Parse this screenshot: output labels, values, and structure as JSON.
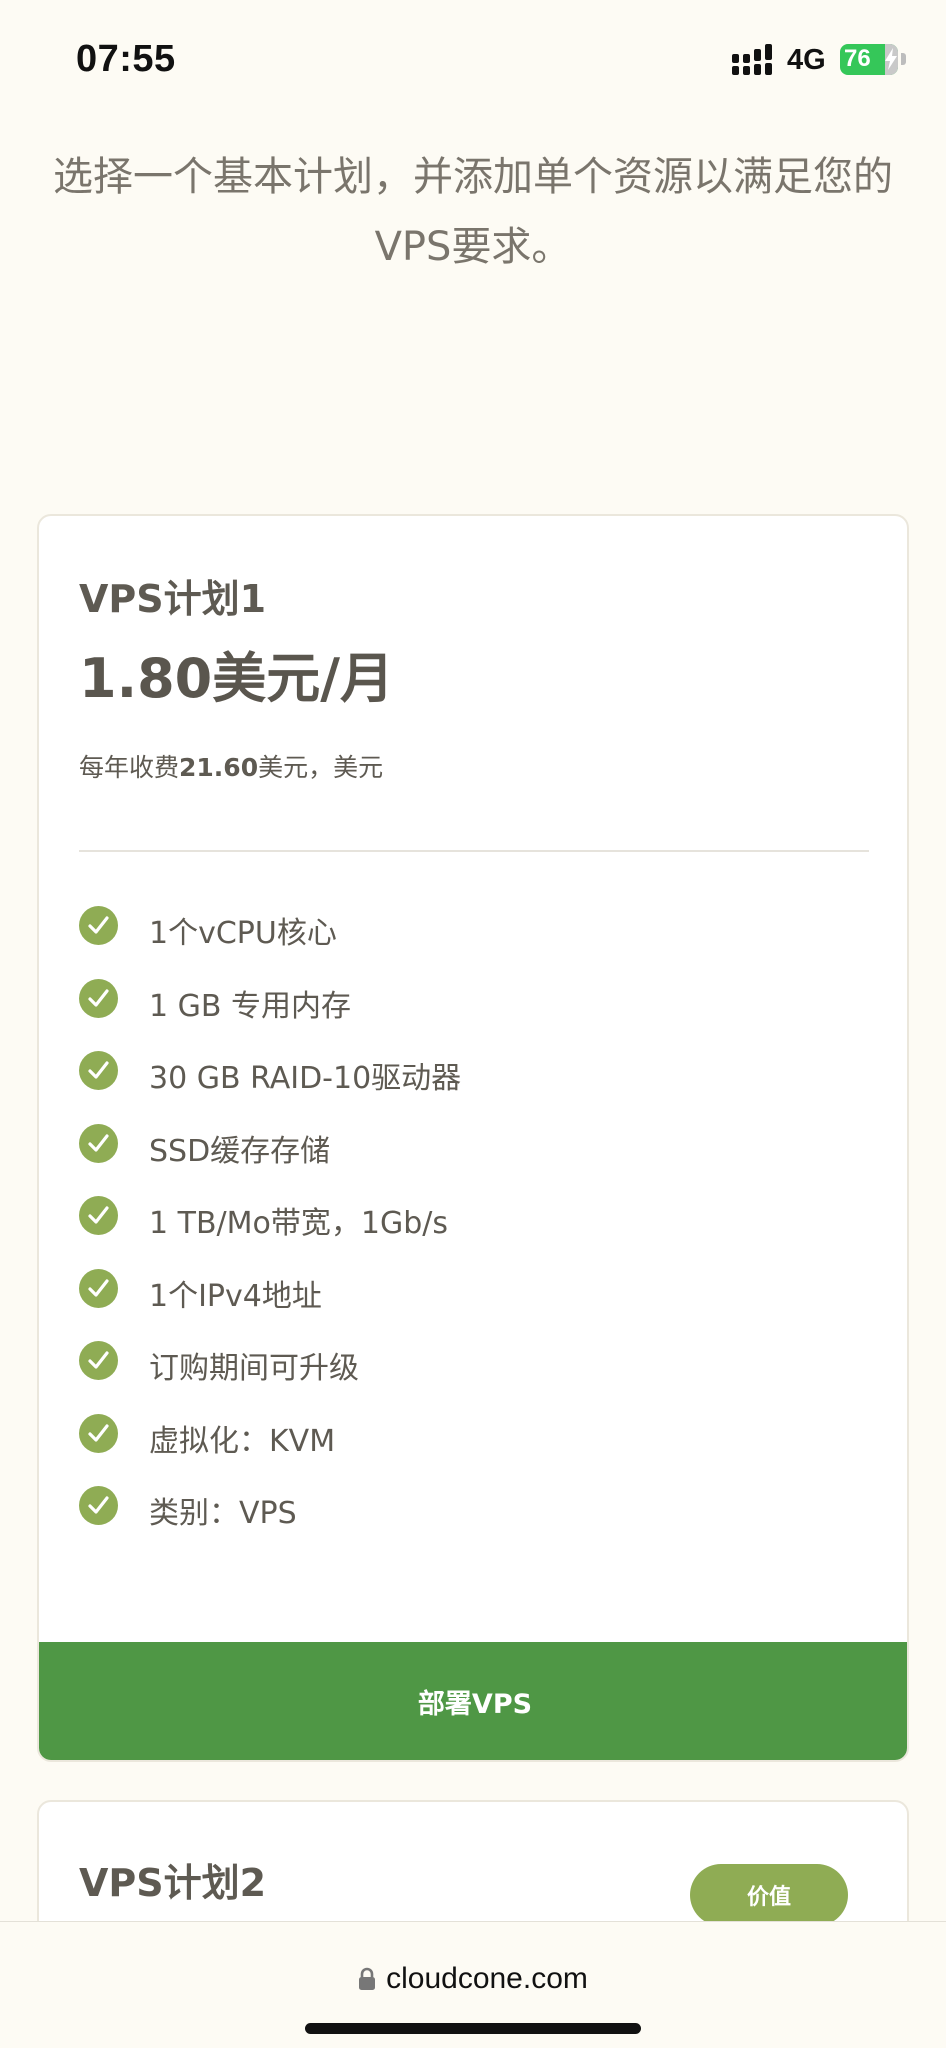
{
  "status_bar": {
    "time": "07:55",
    "network": "4G",
    "battery": "76"
  },
  "intro_text": "选择一个基本计划，并添加单个资源以满足您的VPS要求。",
  "plan1": {
    "name": "VPS计划1",
    "price": "1.80美元/月",
    "annual_prefix": "每年收费",
    "annual_amount": "21.60",
    "annual_suffix": "美元，美元",
    "features": [
      "1个vCPU核心",
      "1 GB 专用内存",
      "30 GB RAID-10驱动器",
      "SSD缓存存储",
      "1 TB/Mo带宽，1Gb/s",
      "1个IPv4地址",
      "订购期间可升级",
      "虚拟化：KVM",
      "类别：VPS"
    ],
    "deploy_label": "部署VPS"
  },
  "plan2": {
    "name": "VPS计划2",
    "badge": "价值"
  },
  "browser": {
    "url": "cloudcone.com"
  },
  "colors": {
    "accent_green": "#4f9745",
    "check_green": "#8fac54",
    "background": "#fdfbf4"
  }
}
